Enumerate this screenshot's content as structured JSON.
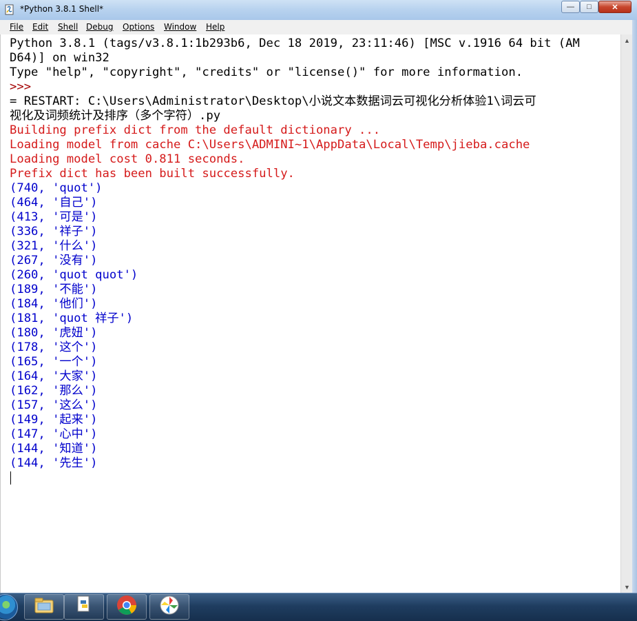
{
  "window": {
    "title": "*Python 3.8.1 Shell*",
    "min_symbol": "—",
    "max_symbol": "□",
    "close_symbol": "✕"
  },
  "menu": {
    "items": [
      "File",
      "Edit",
      "Shell",
      "Debug",
      "Options",
      "Window",
      "Help"
    ]
  },
  "shell": {
    "lines": [
      {
        "text": "Python 3.8.1 (tags/v3.8.1:1b293b6, Dec 18 2019, 23:11:46) [MSC v.1916 64 bit (AM",
        "style": "black"
      },
      {
        "text": "D64)] on win32",
        "style": "black"
      },
      {
        "text": "Type \"help\", \"copyright\", \"credits\" or \"license()\" for more information.",
        "style": "black"
      },
      {
        "text": ">>>",
        "style": "prompt"
      },
      {
        "text": "= RESTART: C:\\Users\\Administrator\\Desktop\\小说文本数据词云可视化分析体验1\\词云可",
        "style": "black"
      },
      {
        "text": "视化及词频统计及排序（多个字符）.py",
        "style": "black"
      },
      {
        "text": "Building prefix dict from the default dictionary ...",
        "style": "red"
      },
      {
        "text": "Loading model from cache C:\\Users\\ADMINI~1\\AppData\\Local\\Temp\\jieba.cache",
        "style": "red"
      },
      {
        "text": "Loading model cost 0.811 seconds.",
        "style": "red"
      },
      {
        "text": "Prefix dict has been built successfully.",
        "style": "red"
      },
      {
        "text": "(740, 'quot')",
        "style": "blue"
      },
      {
        "text": "(464, '自己')",
        "style": "blue"
      },
      {
        "text": "(413, '可是')",
        "style": "blue"
      },
      {
        "text": "(336, '祥子')",
        "style": "blue"
      },
      {
        "text": "(321, '什么')",
        "style": "blue"
      },
      {
        "text": "(267, '没有')",
        "style": "blue"
      },
      {
        "text": "(260, 'quot quot')",
        "style": "blue"
      },
      {
        "text": "(189, '不能')",
        "style": "blue"
      },
      {
        "text": "(184, '他们')",
        "style": "blue"
      },
      {
        "text": "(181, 'quot 祥子')",
        "style": "blue"
      },
      {
        "text": "(180, '虎妞')",
        "style": "blue"
      },
      {
        "text": "(178, '这个')",
        "style": "blue"
      },
      {
        "text": "(165, '一个')",
        "style": "blue"
      },
      {
        "text": "(164, '大家')",
        "style": "blue"
      },
      {
        "text": "(162, '那么')",
        "style": "blue"
      },
      {
        "text": "(157, '这么')",
        "style": "blue"
      },
      {
        "text": "(149, '起来')",
        "style": "blue"
      },
      {
        "text": "(147, '心中')",
        "style": "blue"
      },
      {
        "text": "(144, '知道')",
        "style": "blue"
      },
      {
        "text": "(144, '先生')",
        "style": "blue"
      }
    ]
  },
  "scrollbar": {
    "up_symbol": "▲",
    "down_symbol": "▼"
  },
  "taskbar": {
    "buttons": [
      {
        "name": "windows-explorer",
        "icon": "folder-icon"
      },
      {
        "name": "python-idle",
        "icon": "python-icon"
      },
      {
        "name": "google-chrome",
        "icon": "chrome-icon"
      },
      {
        "name": "paint-app",
        "icon": "pinwheel-icon"
      }
    ]
  },
  "colors": {
    "stdout_black": "#000000",
    "stderr_red": "#d51a1a",
    "result_blue": "#0000cc",
    "prompt": "#a30000"
  }
}
